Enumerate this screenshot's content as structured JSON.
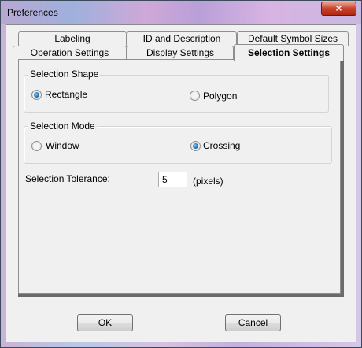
{
  "window": {
    "title": "Preferences",
    "close_glyph": "×"
  },
  "tabs": {
    "back_row": [
      "Labeling",
      "ID and Description",
      "Default Symbol Sizes"
    ],
    "front_row": [
      "Operation Settings",
      "Display Settings",
      "Selection Settings"
    ],
    "active": "Selection Settings"
  },
  "selection_shape": {
    "label": "Selection Shape",
    "options": [
      "Rectangle",
      "Polygon"
    ],
    "selected": "Rectangle"
  },
  "selection_mode": {
    "label": "Selection Mode",
    "options": [
      "Window",
      "Crossing"
    ],
    "selected": "Crossing"
  },
  "tolerance": {
    "label": "Selection Tolerance:",
    "value": "5",
    "unit": "(pixels)"
  },
  "buttons": {
    "ok": "OK",
    "cancel": "Cancel"
  }
}
